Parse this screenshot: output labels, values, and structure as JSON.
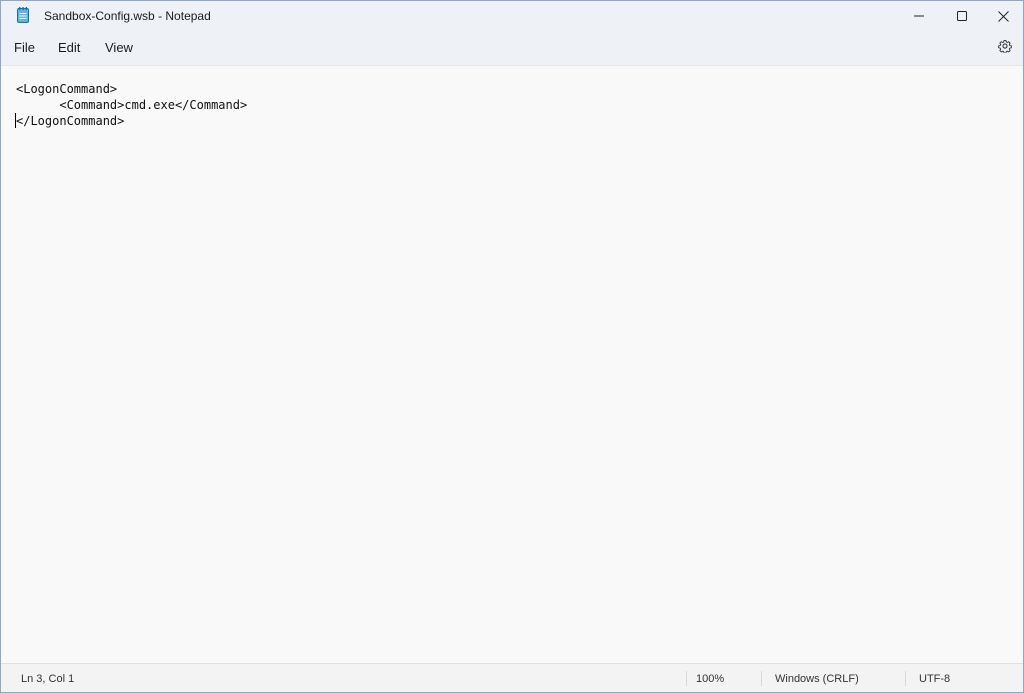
{
  "window": {
    "title": "Sandbox-Config.wsb - Notepad",
    "app_icon": "notepad-icon",
    "controls": {
      "minimize_icon": "minimize-icon",
      "maximize_icon": "maximize-icon",
      "close_icon": "close-icon"
    }
  },
  "menu": {
    "items": [
      {
        "label": "File"
      },
      {
        "label": "Edit"
      },
      {
        "label": "View"
      }
    ],
    "settings_icon": "gear-icon"
  },
  "editor": {
    "lines": [
      "<LogonCommand>",
      "      <Command>cmd.exe</Command>",
      "</LogonCommand>"
    ]
  },
  "status": {
    "position": "Ln 3, Col 1",
    "zoom": "100%",
    "line_ending": "Windows (CRLF)",
    "encoding": "UTF-8"
  },
  "colors": {
    "titlebar_bg": "#eef2f7",
    "editor_bg": "#f9f9f9",
    "icon_accent": "#1e88c8"
  }
}
